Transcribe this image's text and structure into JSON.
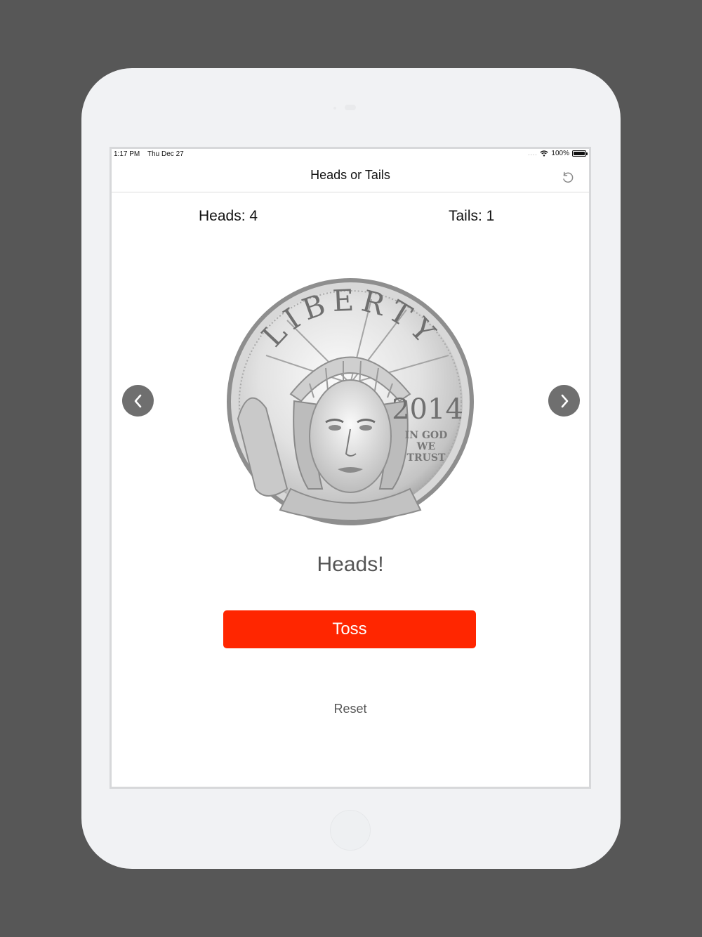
{
  "status_bar": {
    "time": "1:17 PM",
    "date": "Thu Dec 27",
    "signal": "....",
    "battery": "100%"
  },
  "nav": {
    "title": "Heads or Tails",
    "refresh_icon": "refresh-icon"
  },
  "scores": {
    "heads": "Heads: 4",
    "tails": "Tails: 1"
  },
  "coin": {
    "legend": "LIBERTY",
    "year": "2014",
    "motto_line1": "IN GOD",
    "motto_line2": "WE",
    "motto_line3": "TRUST"
  },
  "navigation": {
    "prev_icon": "chevron-left-icon",
    "next_icon": "chevron-right-icon"
  },
  "result": "Heads!",
  "toss_label": "Toss",
  "reset_label": "Reset",
  "colors": {
    "background": "#575757",
    "device": "#f1f2f4",
    "accent": "#ff2600",
    "arrow": "#6f6f6f"
  }
}
